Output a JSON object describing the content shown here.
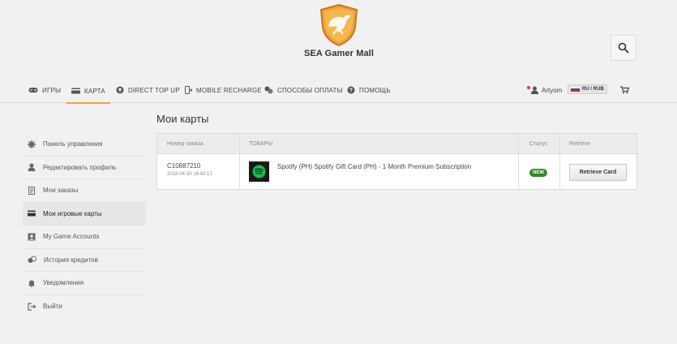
{
  "header": {
    "logo_text": "SEA Gamer Mall"
  },
  "nav": {
    "items": [
      {
        "label": "ИГРЫ",
        "icon": "gamepad-icon"
      },
      {
        "label": "КАРТА",
        "icon": "card-icon",
        "active": true
      },
      {
        "label": "DIRECT TOP UP",
        "icon": "topup-icon"
      },
      {
        "label": "MOBILE RECHARGE",
        "icon": "mobile-icon"
      },
      {
        "label": "СПОСОБЫ ОПЛАТЫ",
        "icon": "payment-icon"
      },
      {
        "label": "ПОМОЩЬ",
        "icon": "help-icon"
      }
    ],
    "user_name": "Artyom",
    "currency": "RU / RUB"
  },
  "sidebar": {
    "items": [
      {
        "label": "Панель управления",
        "icon": "gear-icon"
      },
      {
        "label": "Редактировать профиль",
        "icon": "user-icon"
      },
      {
        "label": "Мои заказы",
        "icon": "orders-icon"
      },
      {
        "label": "Мои игровые карты",
        "icon": "card-icon",
        "active": true
      },
      {
        "label": "My Game Accounts",
        "icon": "accounts-icon"
      },
      {
        "label": "История кредитов",
        "icon": "credits-icon"
      },
      {
        "label": "Уведомления",
        "icon": "bell-icon"
      },
      {
        "label": "Выйти",
        "icon": "logout-icon"
      }
    ]
  },
  "main": {
    "title": "Мои карты",
    "table": {
      "headers": {
        "order": "Номер заказа",
        "goods": "ТОВАРЫ",
        "status": "Статус",
        "retrieve": "Retrieve"
      },
      "rows": [
        {
          "order_id": "C10887210",
          "date": "2018-04-30 16:42:13",
          "product": "Spotify (PH) Spotify Gift Card (PH) - 1 Month Premium Subscription",
          "status": "NEW",
          "action": "Retrieve Card"
        }
      ]
    }
  },
  "colors": {
    "accent": "#f0a33a",
    "status_new": "#2e8b1f",
    "spotify": "#1db954"
  }
}
